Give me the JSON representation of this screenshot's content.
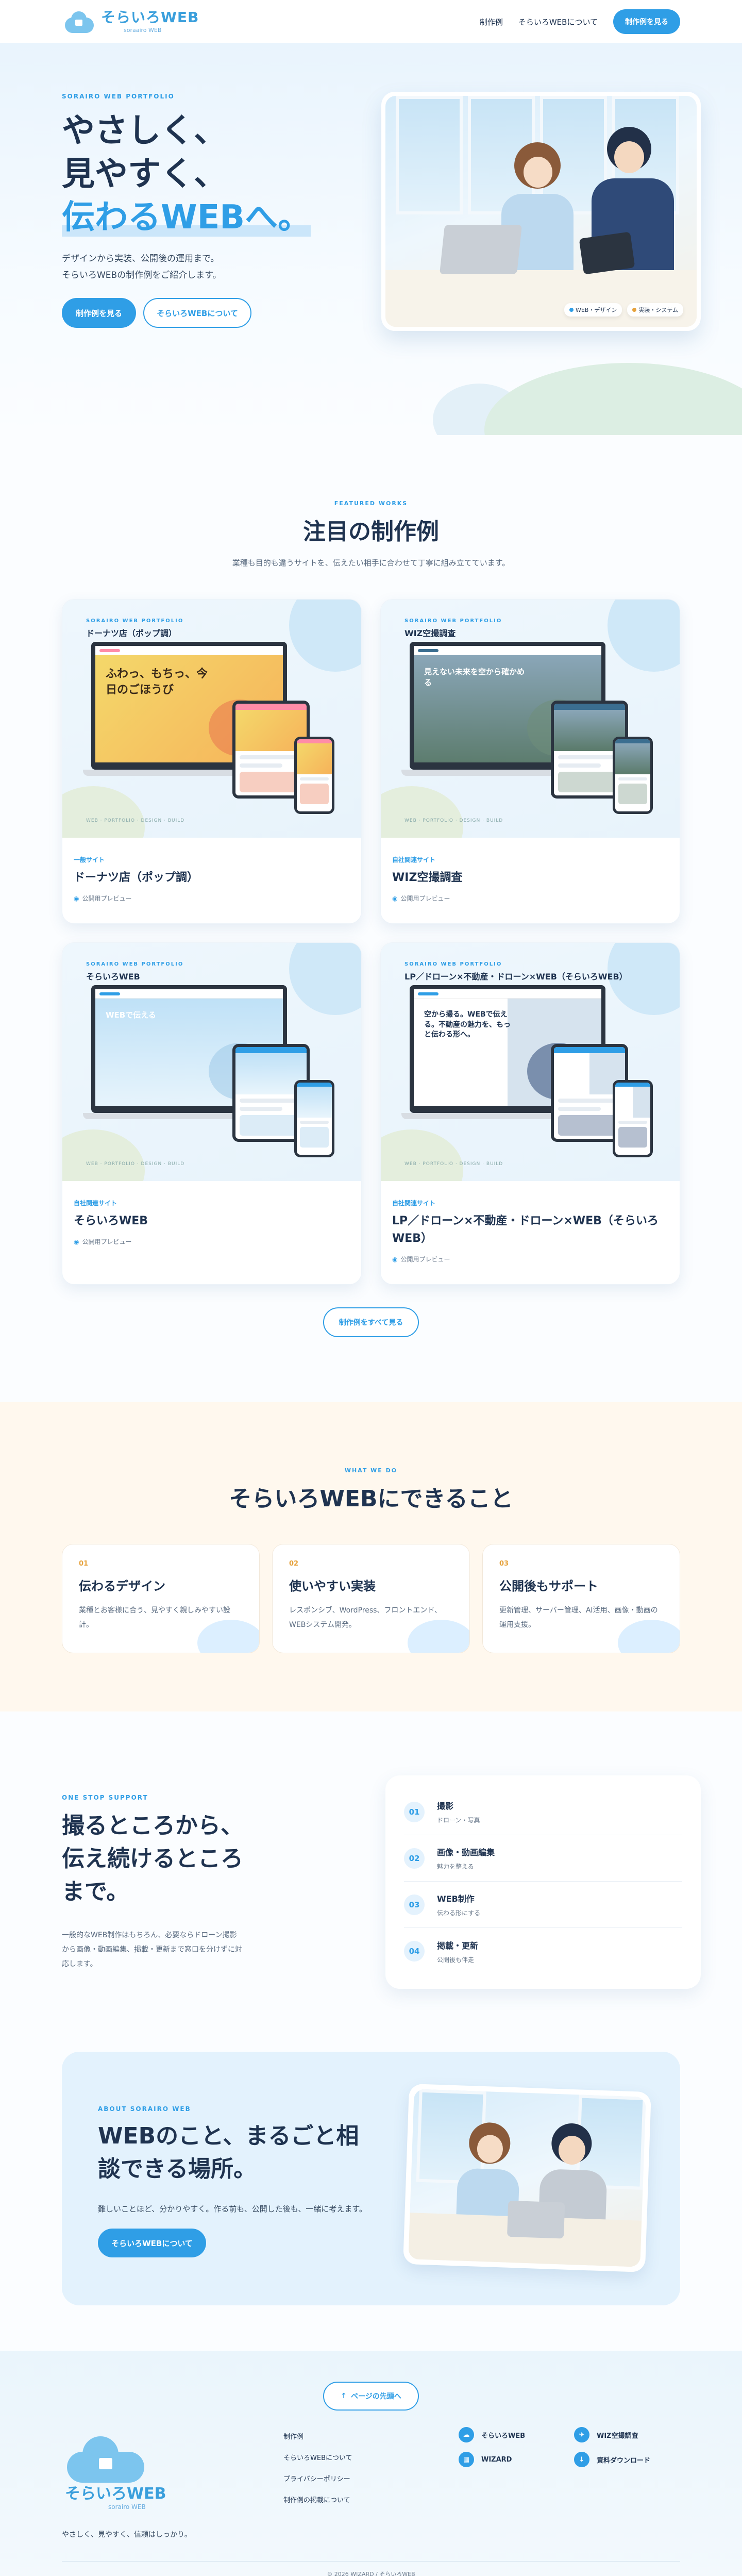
{
  "header": {
    "logo_main": "そらいろWEB",
    "logo_sub": "soraairo WEB",
    "nav": [
      "制作例",
      "そらいろWEBについて"
    ],
    "cta": "制作例を見る"
  },
  "hero": {
    "eyebrow": "SORAIRO WEB PORTFOLIO",
    "line1": "やさしく、",
    "line2": "見やすく、",
    "line3": "伝わるWEBへ。",
    "desc1": "デザインから実装、公開後の運用まで。",
    "desc2": "そらいろWEBの制作例をご紹介します。",
    "btn_primary": "制作例を見る",
    "btn_secondary": "そらいろWEBについて",
    "tags": [
      "WEB・デザイン",
      "実装・システム"
    ]
  },
  "works": {
    "eyebrow": "FEATURED WORKS",
    "title": "注目の制作例",
    "subtitle": "業種も目的も違うサイトを、伝えたい相手に合わせて丁寧に組み立てています。",
    "items": [
      {
        "cap": "SORAIRO WEB PORTFOLIO",
        "cap2": "ドーナツ店（ポップ調）",
        "hero_text": "ふわっ、もちっ、今日のごほうび",
        "kind": "一般サイト",
        "title": "ドーナツ店（ポップ調）",
        "meta": "公開用プレビュー",
        "theme": "donut"
      },
      {
        "cap": "SORAIRO WEB PORTFOLIO",
        "cap2": "WIZ空撮調査",
        "hero_text": "見えない未来を空から確かめる",
        "kind": "自社関連サイト",
        "title": "WIZ空撮調査",
        "meta": "公開用プレビュー",
        "theme": "aerial"
      },
      {
        "cap": "SORAIRO WEB PORTFOLIO",
        "cap2": "そらいろWEB",
        "hero_text": "WEBで伝える",
        "kind": "自社関連サイト",
        "title": "そらいろWEB",
        "meta": "公開用プレビュー",
        "theme": "sky"
      },
      {
        "cap": "SORAIRO WEB PORTFOLIO",
        "cap2": "LP／ドローン×不動産・ドローン×WEB（そらいろWEB）",
        "hero_text": "空から撮る。WEBで伝える。不動産の魅力を、もっと伝わる形へ。",
        "kind": "自社関連サイト",
        "title": "LP／ドローン×不動産・ドローン×WEB（そらいろWEB）",
        "meta": "公開用プレビュー",
        "theme": "lp"
      }
    ],
    "more": "制作例をすべて見る",
    "thumb_foot": "WEB · PORTFOLIO · DESIGN · BUILD"
  },
  "cando": {
    "eyebrow": "WHAT WE DO",
    "title": "そらいろWEBにできること",
    "items": [
      {
        "num": "01",
        "title": "伝わるデザイン",
        "desc": "業種とお客様に合う、見やすく親しみやすい設計。"
      },
      {
        "num": "02",
        "title": "使いやすい実装",
        "desc": "レスポンシブ、WordPress、フロントエンド、WEBシステム開発。"
      },
      {
        "num": "03",
        "title": "公開後もサポート",
        "desc": "更新管理、サーバー管理、AI活用、画像・動画の運用支援。"
      }
    ]
  },
  "onestop": {
    "eyebrow": "ONE STOP SUPPORT",
    "line1": "撮るところから、",
    "line2": "伝え続けるところ",
    "line3": "まで。",
    "desc": "一般的なWEB制作はもちろん、必要ならドローン撮影から画像・動画編集、掲載・更新まで窓口を分けずに対応します。",
    "steps": [
      {
        "n": "01",
        "title": "撮影",
        "sub": "ドローン・写真"
      },
      {
        "n": "02",
        "title": "画像・動画編集",
        "sub": "魅力を整える"
      },
      {
        "n": "03",
        "title": "WEB制作",
        "sub": "伝わる形にする"
      },
      {
        "n": "04",
        "title": "掲載・更新",
        "sub": "公開後も伴走"
      }
    ]
  },
  "about": {
    "eyebrow": "ABOUT SORAIRO WEB",
    "line1": "WEBのこと、まるごと相",
    "line2": "談できる場所。",
    "desc": "難しいことほど、分かりやすく。作る前も、公開した後も、一緒に考えます。",
    "btn": "そらいろWEBについて"
  },
  "footer": {
    "to_top": "ページの先頭へ",
    "logo_main": "そらいろWEB",
    "logo_sub": "sorairo WEB",
    "tagline": "やさしく、見やすく、信頼はしっかり。",
    "links": [
      "制作例",
      "そらいろWEBについて",
      "プライバシーポリシー",
      "制作例の掲載について"
    ],
    "sns": [
      [
        "そらいろWEB",
        "WIZ空撮調査"
      ],
      [
        "WIZARD",
        "資料ダウンロード"
      ]
    ],
    "copyright": "© 2026 WIZARD / そらいろWEB"
  },
  "colors": {
    "accent": "#2f9ee6",
    "text": "#1f3350",
    "cream": "#fff8ee",
    "light": "#e3f2fd"
  }
}
